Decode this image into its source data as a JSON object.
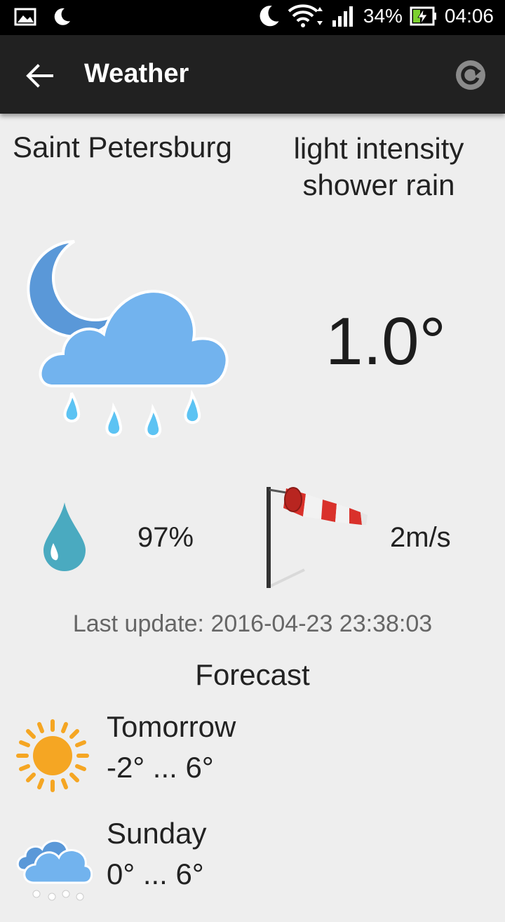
{
  "status_bar": {
    "battery": "34%",
    "time": "04:06"
  },
  "app_bar": {
    "title": "Weather"
  },
  "current": {
    "city": "Saint Petersburg",
    "description": "light intensity shower rain",
    "temperature": "1.0°",
    "humidity": "97%",
    "wind": "2m/s",
    "last_update": "Last update: 2016-04-23 23:38:03"
  },
  "forecast": {
    "title": "Forecast",
    "items": [
      {
        "day": "Tomorrow",
        "range": "-2° ... 6°",
        "icon": "sun-icon"
      },
      {
        "day": "Sunday",
        "range": "0° ... 6°",
        "icon": "cloud-snow-icon"
      }
    ]
  },
  "colors": {
    "app_bar": "#212121",
    "background": "#eeeeee",
    "cloud": "#6fb1ec",
    "rain": "#5bc0f0",
    "sun": "#f5a623",
    "droplet": "#4aaac0"
  }
}
